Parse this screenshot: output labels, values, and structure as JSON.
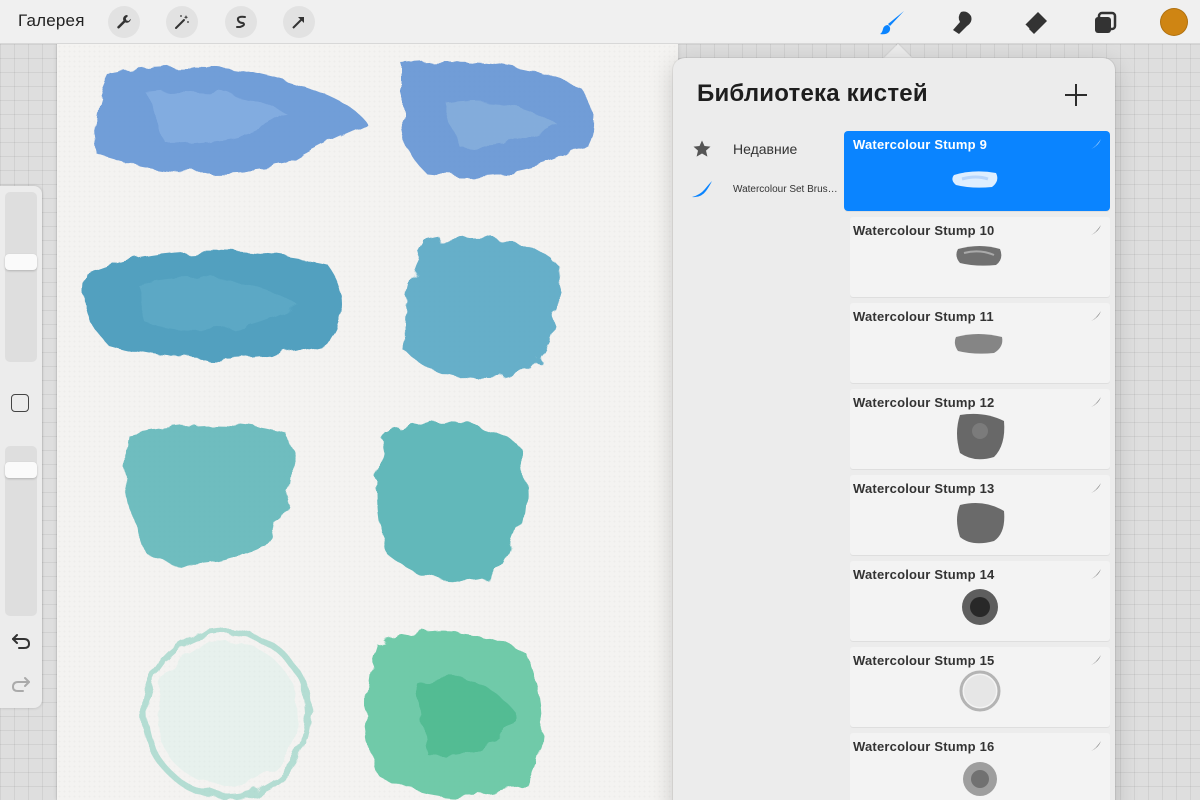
{
  "topbar": {
    "gallery_label": "Галерея",
    "left_tools": [
      {
        "name": "wrench-icon"
      },
      {
        "name": "magic-wand-icon"
      },
      {
        "name": "selection-icon"
      },
      {
        "name": "transform-arrow-icon"
      }
    ],
    "right_tools": [
      {
        "name": "brush-icon",
        "active": true
      },
      {
        "name": "smudge-icon"
      },
      {
        "name": "eraser-icon"
      },
      {
        "name": "layers-icon"
      }
    ],
    "current_color": "#cf8513",
    "accent_color": "#0a84ff"
  },
  "brush_library": {
    "title": "Библиотека кистей",
    "add_icon": "plus-icon",
    "categories": [
      {
        "label": "Недавние",
        "icon": "star-icon"
      },
      {
        "label": "Watercolour Set Brus…",
        "icon": "brush-stroke-icon"
      }
    ],
    "brushes": [
      {
        "name": "Watercolour Stump 9",
        "selected": true
      },
      {
        "name": "Watercolour Stump 10",
        "selected": false
      },
      {
        "name": "Watercolour Stump 11",
        "selected": false
      },
      {
        "name": "Watercolour Stump 12",
        "selected": false
      },
      {
        "name": "Watercolour Stump 13",
        "selected": false
      },
      {
        "name": "Watercolour Stump 14",
        "selected": false
      },
      {
        "name": "Watercolour Stump 15",
        "selected": false
      },
      {
        "name": "Watercolour Stump 16",
        "selected": false
      }
    ]
  },
  "sidebar": {
    "brush_size_icon": "slider",
    "opacity_icon": "slider",
    "modify_icon": "square-icon",
    "undo_icon": "undo-icon",
    "redo_icon": "redo-icon"
  }
}
